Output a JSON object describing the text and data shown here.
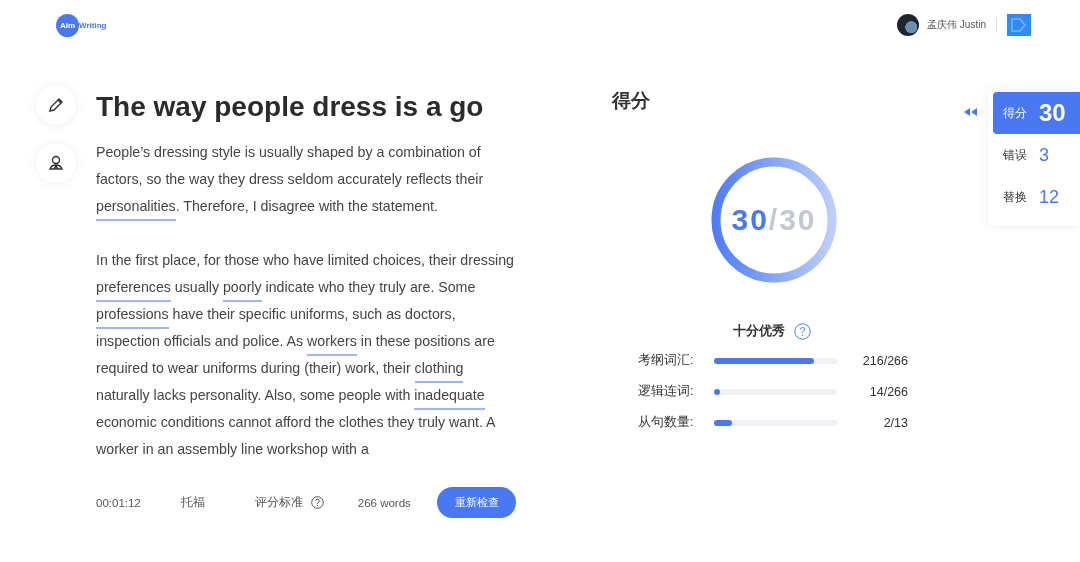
{
  "header": {
    "logo_badge": "Aim",
    "logo_text": "Writing",
    "user_name": "孟庆伟 Justin"
  },
  "essay": {
    "title": "The way people dress is a go",
    "paragraphs": [
      [
        {
          "text": "People’s dressing style is usually shaped by a combination of factors, so the way they dress seldom accurately reflects their ",
          "underlined": false
        },
        {
          "text": "personalities",
          "underlined": true
        },
        {
          "text": ". Therefore, I disagree with the statement.",
          "underlined": false
        }
      ],
      [
        {
          "text": "In the first place, for those who have limited choices, their dressing ",
          "underlined": false
        },
        {
          "text": "preferences",
          "underlined": true
        },
        {
          "text": " usually ",
          "underlined": false
        },
        {
          "text": "poorly",
          "underlined": true
        },
        {
          "text": " indicate who they truly are. Some ",
          "underlined": false
        },
        {
          "text": "professions",
          "underlined": true
        },
        {
          "text": " have their specific uniforms, such as doctors, inspection officials and police. As ",
          "underlined": false
        },
        {
          "text": "workers",
          "underlined": true
        },
        {
          "text": " in these positions are required to wear uniforms during (their) work, their ",
          "underlined": false
        },
        {
          "text": "clothing",
          "underlined": true
        },
        {
          "text": " naturally lacks personality. Also, some people with ",
          "underlined": false
        },
        {
          "text": "inadequate",
          "underlined": true
        },
        {
          "text": " economic conditions cannot afford the clothes they truly want. A worker in an assembly line workshop with a",
          "underlined": false
        }
      ]
    ]
  },
  "footer": {
    "timer": "00:01:12",
    "exam": "托福",
    "criteria": "评分标准",
    "word_count": "266 words",
    "recheck_button": "重新检查"
  },
  "score": {
    "heading": "得分",
    "value": "30",
    "total": "/30",
    "level": 1.0,
    "rating": "十分优秀",
    "metrics": [
      {
        "label": "考纲词汇:",
        "level": 0.81,
        "reading": "216/266"
      },
      {
        "label": "逻辑连词:",
        "level": 0.05,
        "reading": "14/266"
      },
      {
        "label": "从句数量:",
        "level": 0.15,
        "reading": "2/13"
      }
    ]
  },
  "side_tabs": [
    {
      "label": "得分",
      "count": "30",
      "selected": true
    },
    {
      "label": "错误",
      "count": "3",
      "selected": false
    },
    {
      "label": "替换",
      "count": "12",
      "selected": false
    }
  ]
}
